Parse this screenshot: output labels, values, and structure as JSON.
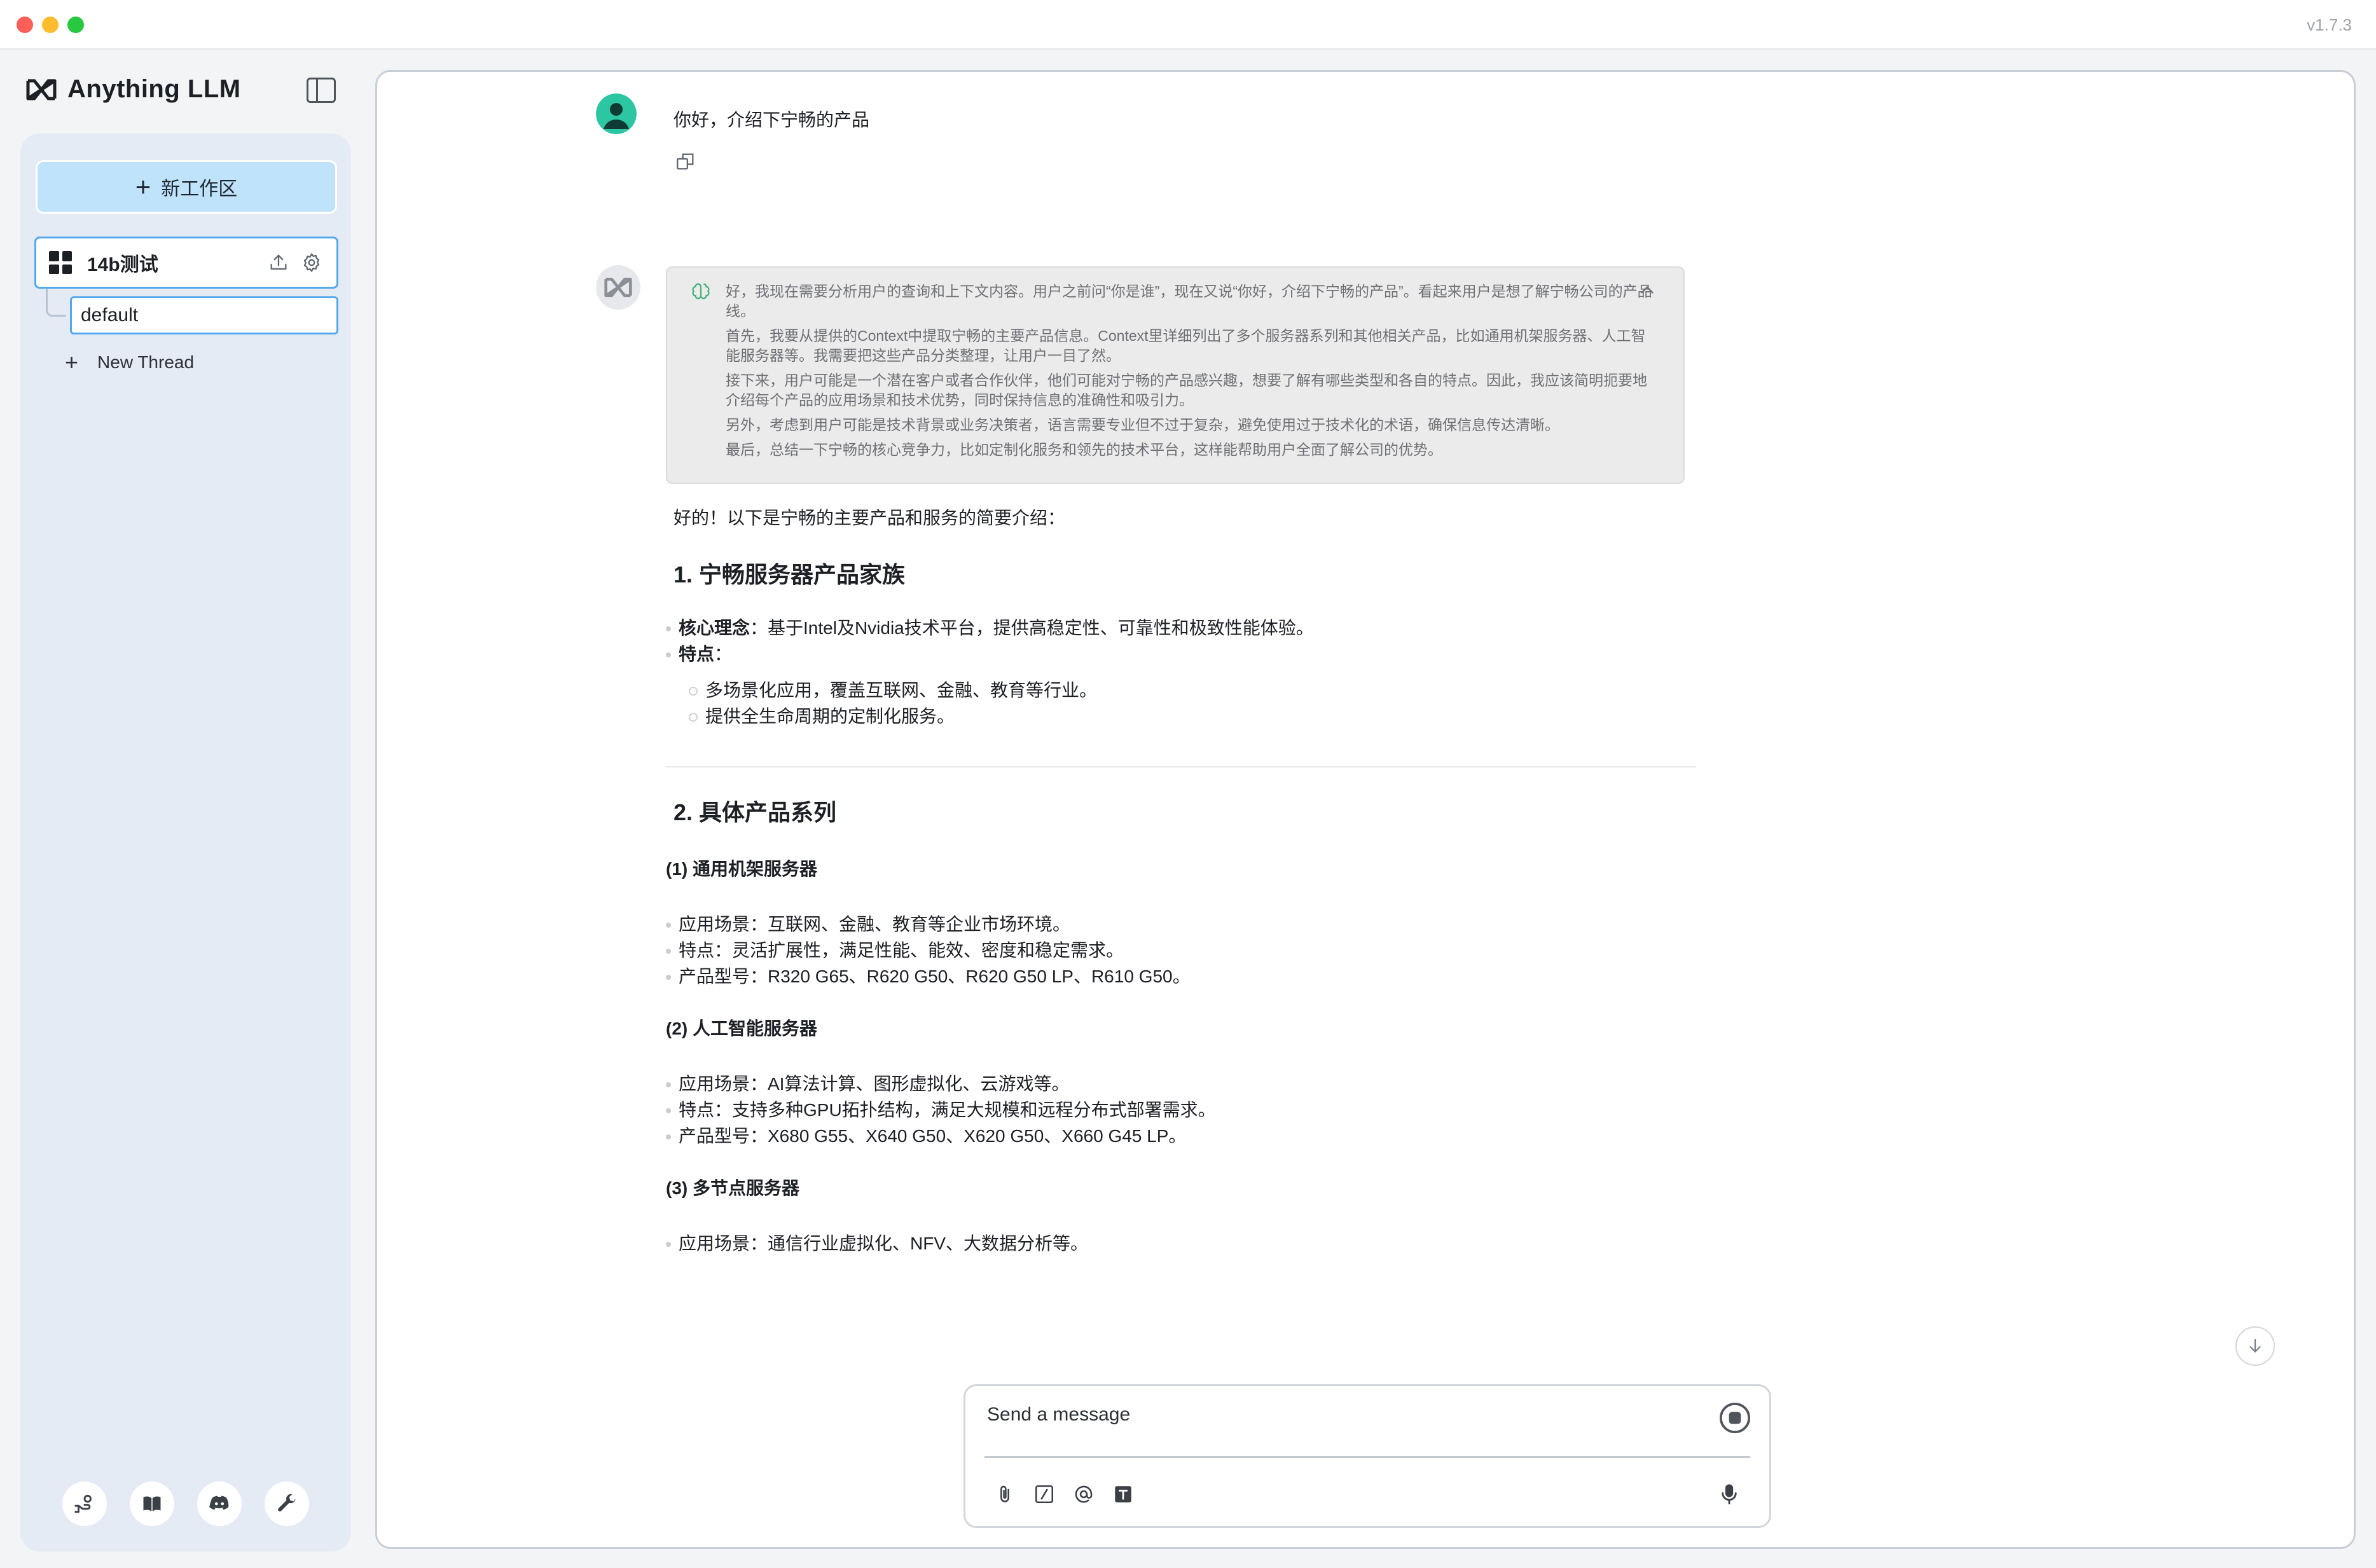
{
  "app": {
    "name": "Anything LLM",
    "version": "v1.7.3"
  },
  "sidebar": {
    "new_workspace_label": "新工作区",
    "workspace": {
      "name": "14b测试"
    },
    "threads": [
      {
        "name": "default"
      }
    ],
    "new_thread_label": "New Thread",
    "footer_icons": [
      "support-icon",
      "docs-book-icon",
      "discord-icon",
      "settings-wrench-icon"
    ]
  },
  "chat": {
    "user_message": "你好，介绍下宁畅的产品",
    "thinking": [
      "好，我现在需要分析用户的查询和上下文内容。用户之前问“你是谁”，现在又说“你好，介绍下宁畅的产品”。看起来用户是想了解宁畅公司的产品线。",
      "首先，我要从提供的Context中提取宁畅的主要产品信息。Context里详细列出了多个服务器系列和其他相关产品，比如通用机架服务器、人工智能服务器等。我需要把这些产品分类整理，让用户一目了然。",
      "接下来，用户可能是一个潜在客户或者合作伙伴，他们可能对宁畅的产品感兴趣，想要了解有哪些类型和各自的特点。因此，我应该简明扼要地介绍每个产品的应用场景和技术优势，同时保持信息的准确性和吸引力。",
      "另外，考虑到用户可能是技术背景或业务决策者，语言需要专业但不过于复杂，避免使用过于技术化的术语，确保信息传达清晰。",
      "最后，总结一下宁畅的核心竞争力，比如定制化服务和领先的技术平台，这样能帮助用户全面了解公司的优势。"
    ],
    "answer": {
      "intro": "好的！以下是宁畅的主要产品和服务的简要介绍：",
      "section1": {
        "title": "1. 宁畅服务器产品家族",
        "core_label": "核心理念",
        "core_text": "：基于Intel及Nvidia技术平台，提供高稳定性、可靠性和极致性能体验。",
        "features_label": "特点",
        "features_colon": "：",
        "features": [
          "多场景化应用，覆盖互联网、金融、教育等行业。",
          "提供全生命周期的定制化服务。"
        ]
      },
      "section2": {
        "title": "2. 具体产品系列",
        "groups": [
          {
            "title": "(1) 通用机架服务器",
            "items": [
              "应用场景：互联网、金融、教育等企业市场环境。",
              "特点：灵活扩展性，满足性能、能效、密度和稳定需求。",
              "产品型号：R320 G65、R620 G50、R620 G50 LP、R610 G50。"
            ]
          },
          {
            "title": "(2) 人工智能服务器",
            "items": [
              "应用场景：AI算法计算、图形虚拟化、云游戏等。",
              "特点：支持多种GPU拓扑结构，满足大规模和远程分布式部署需求。",
              "产品型号：X680 G55、X640 G50、X620 G50、X660 G45 LP。"
            ]
          },
          {
            "title": "(3) 多节点服务器",
            "items": [
              "应用场景：通信行业虚拟化、NFV、大数据分析等。"
            ]
          }
        ]
      }
    }
  },
  "composer": {
    "placeholder": "Send a message",
    "tools": [
      "attach-icon",
      "slash-command-icon",
      "at-mention-icon",
      "text-format-icon"
    ]
  }
}
